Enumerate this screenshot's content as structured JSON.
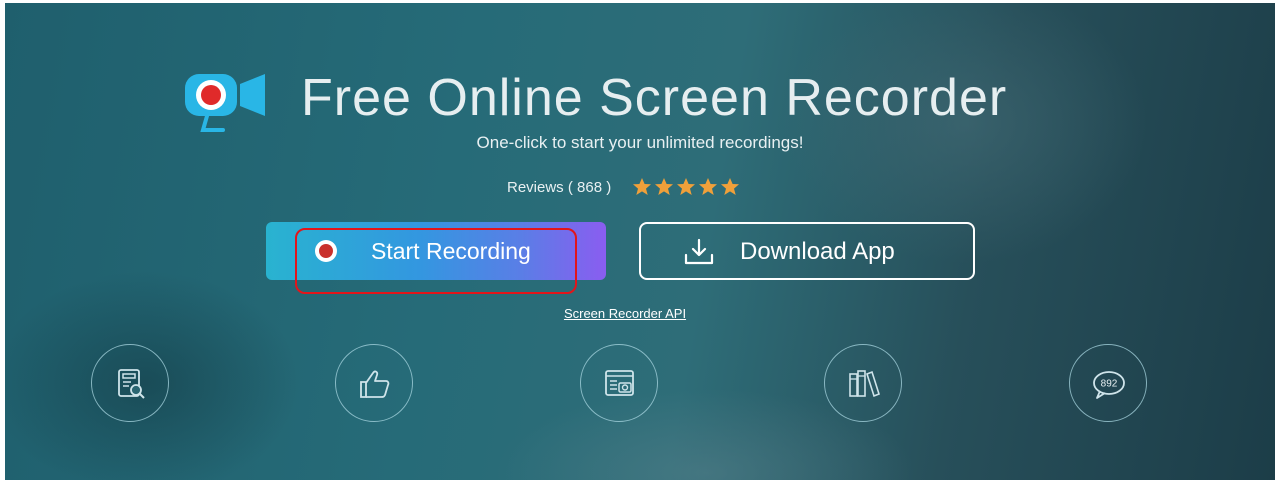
{
  "hero": {
    "title": "Free Online Screen Recorder",
    "subtitle": "One-click to start your unlimited recordings!",
    "reviews_text": "Reviews ( 868 )",
    "rating_stars": 5,
    "star_color": "#f0a03a"
  },
  "buttons": {
    "start_recording": "Start Recording",
    "download_app": "Download App"
  },
  "links": {
    "api": "Screen Recorder API"
  },
  "features": [
    {
      "icon": "report-search-icon"
    },
    {
      "icon": "thumbs-up-icon"
    },
    {
      "icon": "screenshot-icon"
    },
    {
      "icon": "books-icon"
    },
    {
      "icon": "comment-count-icon",
      "count": "892"
    }
  ],
  "colors": {
    "logo_blue": "#29b6e6",
    "record_red": "#c9302c",
    "highlight_red": "#e3151a"
  }
}
